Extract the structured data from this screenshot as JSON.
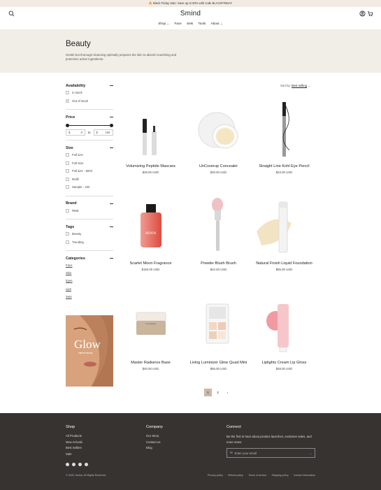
{
  "announcement": "🔥 Black Friday Sale: Save up to 60% with code BLACKFRIDAY",
  "header": {
    "logo": "Smind",
    "nav": [
      "Shop",
      "Face",
      "Sets",
      "Tools",
      "About"
    ]
  },
  "hero": {
    "title": "Beauty",
    "description": "Gentle but thorough cleansing optimally prepares the skin to absorb nourishing and protective active ingredients."
  },
  "filters": {
    "availability": {
      "title": "Availability",
      "options": [
        "In stock",
        "Out of stock"
      ]
    },
    "price": {
      "title": "Price",
      "currency": "$",
      "min": "0",
      "max": "150",
      "to": "to"
    },
    "size": {
      "title": "Size",
      "options": [
        "Full size",
        "Full Size",
        "Full size - 50ml",
        "Refill",
        "Sample - 2ml"
      ]
    },
    "brand": {
      "title": "Brand",
      "options": [
        "RMS"
      ]
    },
    "tags": {
      "title": "Tags",
      "options": [
        "Beauty",
        "Trending"
      ]
    },
    "categories": {
      "title": "Categories",
      "links": [
        "Face",
        "Skin",
        "Eyes",
        "Lips",
        "Sets"
      ]
    }
  },
  "promo": {
    "title": "Glow",
    "subtitle": "natural beauty"
  },
  "sort": {
    "label": "Sort by:",
    "value": "Best selling"
  },
  "products": [
    {
      "name": "Volumizing Peptide Mascara",
      "price": "$29.00 USD"
    },
    {
      "name": "UnCoverup Concealer",
      "price": "$30.00 USD"
    },
    {
      "name": "Straight Line Kohl Eye Pencil",
      "price": "$23.00 USD"
    },
    {
      "name": "Scarlet Moon Fragrance",
      "price": "$150.00 USD"
    },
    {
      "name": "Powder Blush Brush",
      "price": "$42.00 USD"
    },
    {
      "name": "Natural Finish Liquid Foundation",
      "price": "$55.00 USD"
    },
    {
      "name": "Master Radiance Base",
      "price": "$40.00 USD"
    },
    {
      "name": "Living Luminizer Glow Quad Mini",
      "price": "$55.00 USD"
    },
    {
      "name": "Liplights Cream Lip Gloss",
      "price": "$28.00 USD"
    }
  ],
  "product_labels": {
    "fragrance": "MOON",
    "base": "rms beauty"
  },
  "pagination": [
    "1",
    "2",
    "›"
  ],
  "footer": {
    "shop": {
      "title": "Shop",
      "links": [
        "All Products",
        "New Arrivals",
        "Best Sellers",
        "Sale"
      ]
    },
    "company": {
      "title": "Company",
      "links": [
        "Our Story",
        "Contact us",
        "Blog"
      ]
    },
    "connect": {
      "title": "Connect",
      "text": "Be the first to hear about product launches, exclusive sales, and more news.",
      "placeholder": "Enter your email"
    },
    "copyright": "© 2025, Smind. All Rights Reserved.",
    "links": [
      "Privacy policy",
      "Refund policy",
      "Terms of service",
      "Shipping policy",
      "Contact information"
    ]
  }
}
